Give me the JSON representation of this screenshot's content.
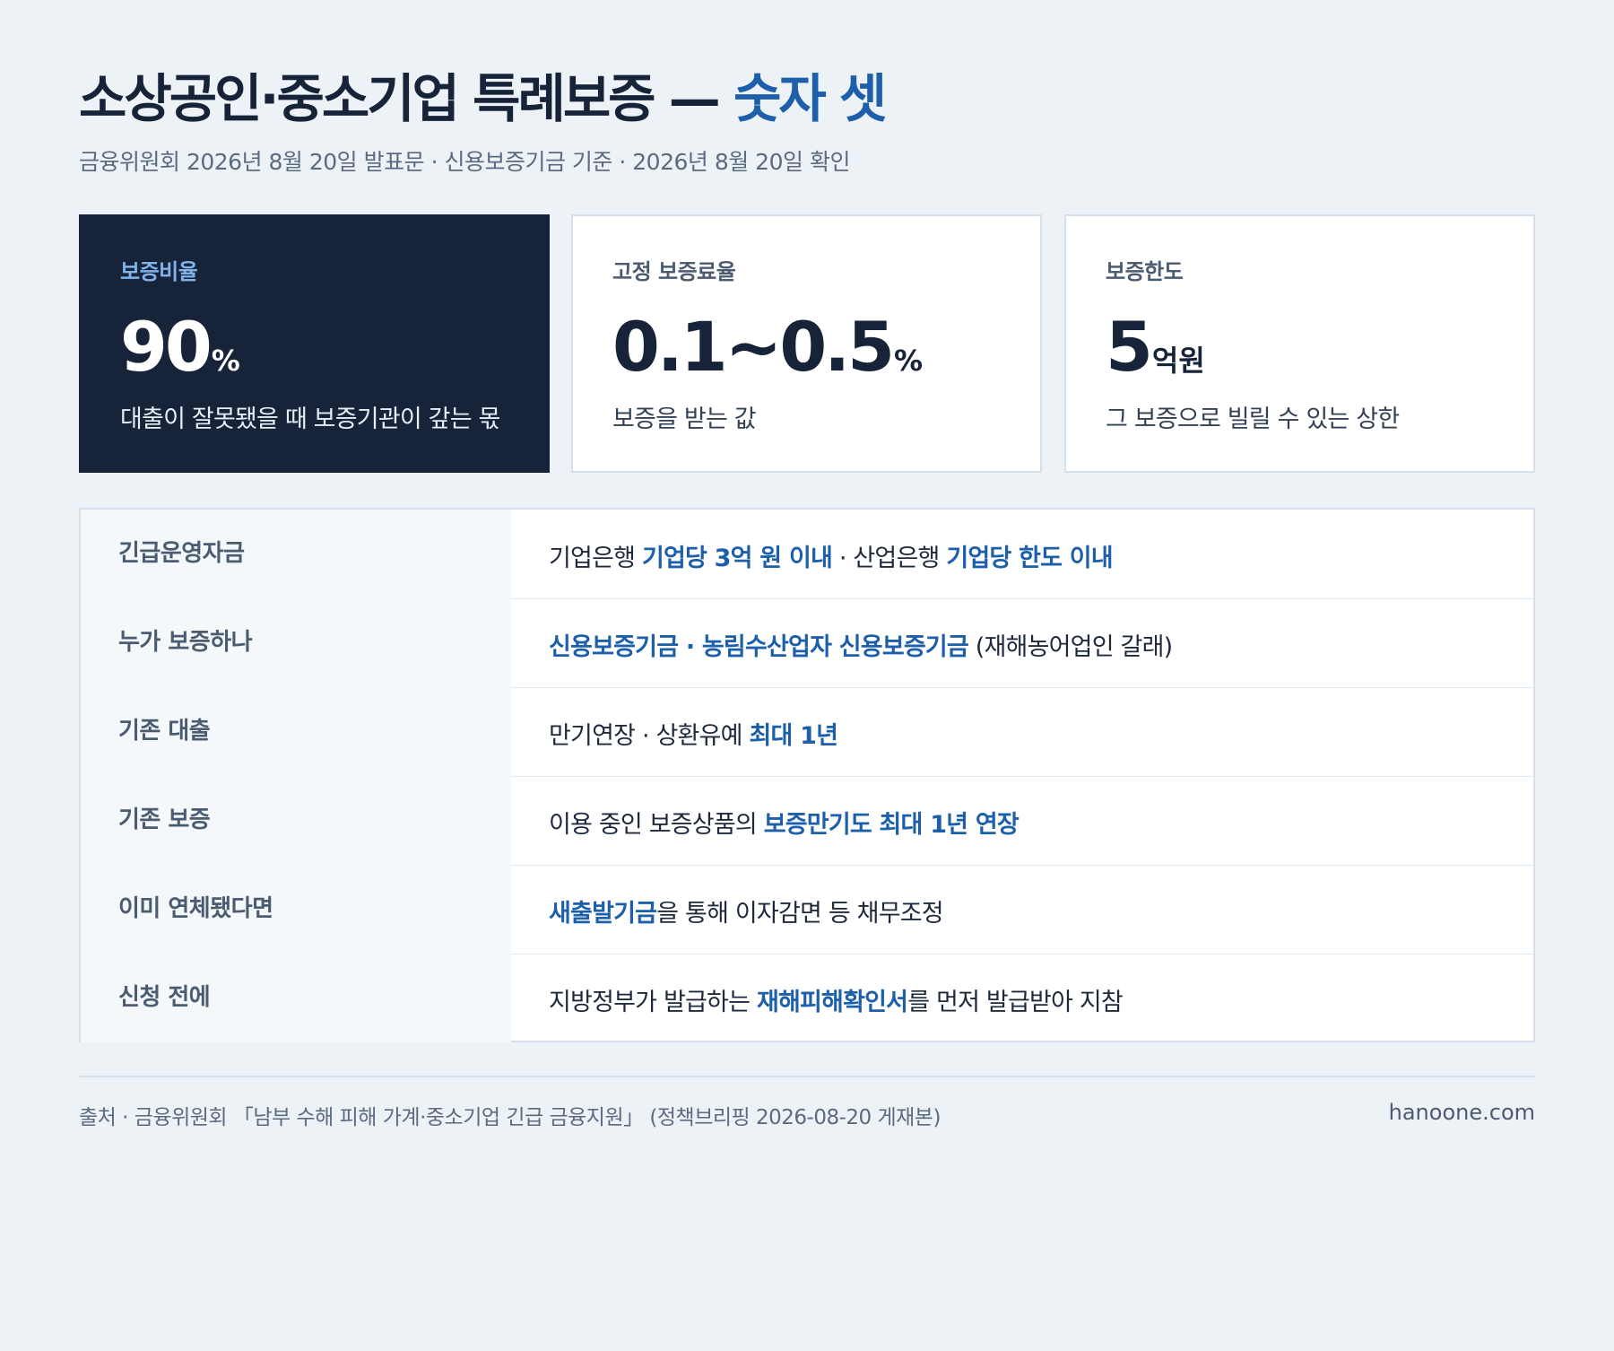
{
  "header": {
    "title_main": "소상공인·중소기업 특례보증 —",
    "title_accent": "숫자 셋",
    "subtitle": "금융위원회 2026년 8월 20일 발표문 · 신용보증기금 기준 · 2026년 8월 20일 확인"
  },
  "cards": [
    {
      "label": "보증비율",
      "value": "90",
      "unit": "%",
      "desc": "대출이 잘못됐을 때 보증기관이 갚는 몫"
    },
    {
      "label": "고정 보증료율",
      "value": "0.1~0.5",
      "unit": "%",
      "desc": "보증을 받는 값"
    },
    {
      "label": "보증한도",
      "value": "5",
      "unit": "억원",
      "desc": "그 보증으로 빌릴 수 있는 상한"
    }
  ],
  "rows": [
    {
      "head": "긴급운영자금",
      "parts": [
        {
          "text": "기업은행 ",
          "em": false
        },
        {
          "text": "기업당 3억 원 이내",
          "em": true
        },
        {
          "text": " · 산업은행 ",
          "em": false
        },
        {
          "text": "기업당 한도 이내",
          "em": true
        }
      ]
    },
    {
      "head": "누가 보증하나",
      "parts": [
        {
          "text": "신용보증기금 · 농림수산업자 신용보증기금",
          "em": true
        },
        {
          "text": " (재해농어업인 갈래)",
          "em": false
        }
      ]
    },
    {
      "head": "기존 대출",
      "parts": [
        {
          "text": "만기연장 · 상환유예 ",
          "em": false
        },
        {
          "text": "최대 1년",
          "em": true
        }
      ]
    },
    {
      "head": "기존 보증",
      "parts": [
        {
          "text": "이용 중인 보증상품의 ",
          "em": false
        },
        {
          "text": "보증만기도 최대 1년 연장",
          "em": true
        }
      ]
    },
    {
      "head": "이미 연체됐다면",
      "parts": [
        {
          "text": "새출발기금",
          "em": true
        },
        {
          "text": "을 통해 이자감면 등 채무조정",
          "em": false
        }
      ]
    },
    {
      "head": "신청 전에",
      "parts": [
        {
          "text": "지방정부가 발급하는 ",
          "em": false
        },
        {
          "text": "재해피해확인서",
          "em": true
        },
        {
          "text": "를 먼저 발급받아 지참",
          "em": false
        }
      ]
    }
  ],
  "footer": {
    "source": "출처 · 금융위원회 「남부 수해 피해 가계·중소기업 긴급 금융지원」 (정책브리핑 2026-08-20 게재본)",
    "site": "hanoone.com"
  }
}
